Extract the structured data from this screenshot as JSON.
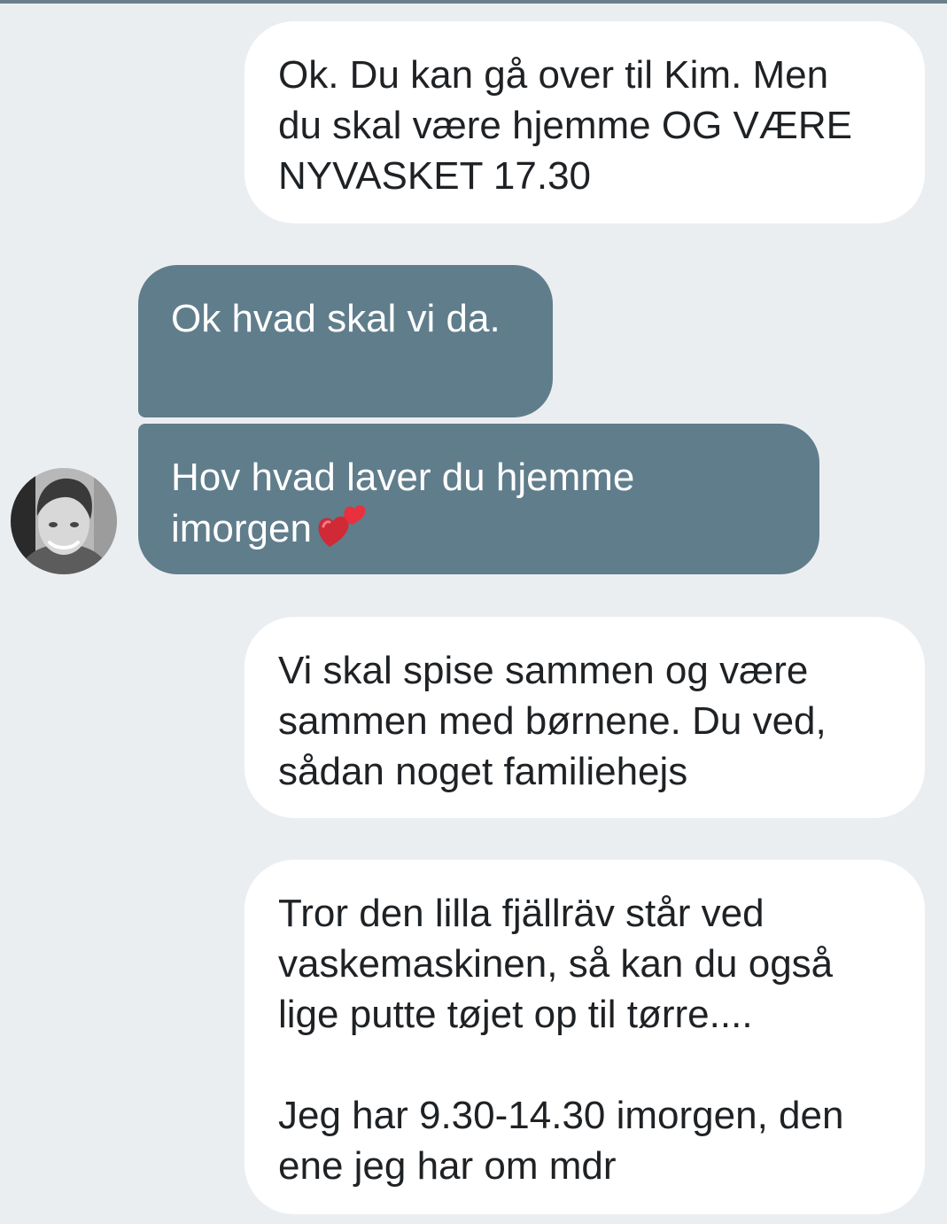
{
  "conversation": {
    "messages": [
      {
        "direction": "outgoing",
        "text": "Ok. Du kan gå over til Kim. Men\ndu skal være hjemme OG VÆRE\nNYVASKET 17.30"
      },
      {
        "direction": "incoming",
        "text": "Ok hvad skal vi da."
      },
      {
        "direction": "incoming",
        "text": "Hov hvad laver du hjemme\nimorgen",
        "emoji": "two-hearts"
      },
      {
        "direction": "outgoing",
        "text": "Vi skal spise sammen og være\nsammen med børnene. Du ved,\nsådan noget familiehejs"
      },
      {
        "direction": "outgoing",
        "text": "Tror den lilla fjällräv står ved\nvaskemaskinen, så kan du også\nlige putte tøjet op til tørre....\n\nJeg har 9.30-14.30 imorgen, den\nene jeg har om mdr"
      }
    ]
  },
  "colors": {
    "background": "#ebeef1",
    "outgoing_bubble": "#ffffff",
    "incoming_bubble": "#607d8b",
    "outgoing_text": "#1f2225",
    "incoming_text": "#ffffff"
  }
}
